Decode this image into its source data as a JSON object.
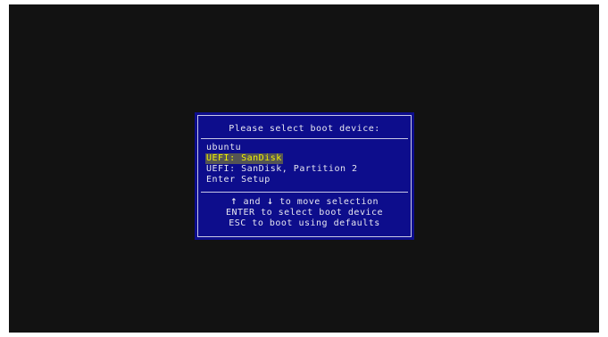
{
  "boot_menu": {
    "title": "Please select boot device:",
    "devices": [
      {
        "label": "ubuntu",
        "selected": false
      },
      {
        "label": "UEFI: SanDisk",
        "selected": true
      },
      {
        "label": "UEFI: SanDisk, Partition 2",
        "selected": false
      },
      {
        "label": "Enter Setup",
        "selected": false
      }
    ],
    "help": {
      "up_arrow_icon": "up-arrow-icon",
      "down_arrow_icon": "down-arrow-icon",
      "line1_and": " and ",
      "line1_rest": " to move selection",
      "line2": "ENTER to select boot device",
      "line3": "ESC to boot using defaults"
    },
    "colors": {
      "background": "#121212",
      "dialog": "#0d0d8c",
      "text": "#e6e6f0",
      "selection_bg": "#555555",
      "selection_text": "#f0f000"
    }
  }
}
